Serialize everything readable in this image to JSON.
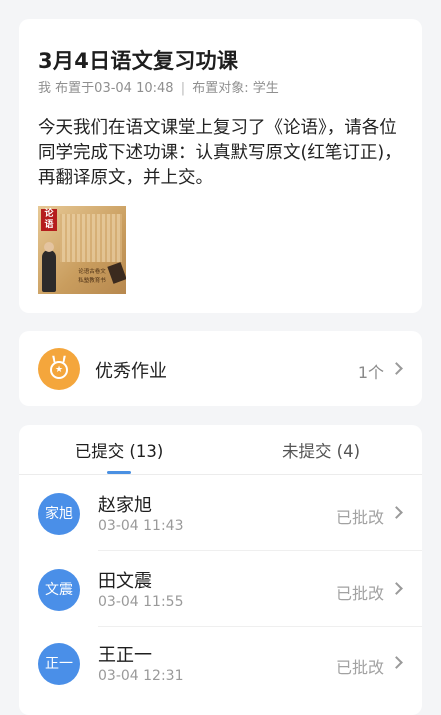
{
  "assignment": {
    "title": "3月4日语文复习功课",
    "author": "我",
    "posted_prefix": "布置于",
    "posted_time": "03-04 10:48",
    "separator": "|",
    "target": "布置对象: 学生",
    "body": "今天我们在语文课堂上复习了《论语》，请各位同学完成下述功课：认真默写原文(红笔订正)，再翻译原文，并上交。",
    "attachment": {
      "seal_text": "论语",
      "caption_line1": "论语古卷文",
      "caption_line2": "私塾教育书"
    }
  },
  "excellent": {
    "label": "优秀作业",
    "count": "1个",
    "icon": "medal-icon",
    "icon_color": "#f4a63c"
  },
  "tabs": {
    "submitted": "已提交 (13)",
    "not_submitted": "未提交 (4)",
    "accent": "#4a90e2"
  },
  "submissions": [
    {
      "avatar": "家旭",
      "name": "赵家旭",
      "time": "03-04 11:43",
      "status": "已批改"
    },
    {
      "avatar": "文震",
      "name": "田文震",
      "time": "03-04 11:55",
      "status": "已批改"
    },
    {
      "avatar": "正一",
      "name": "王正一",
      "time": "03-04 12:31",
      "status": "已批改"
    }
  ]
}
